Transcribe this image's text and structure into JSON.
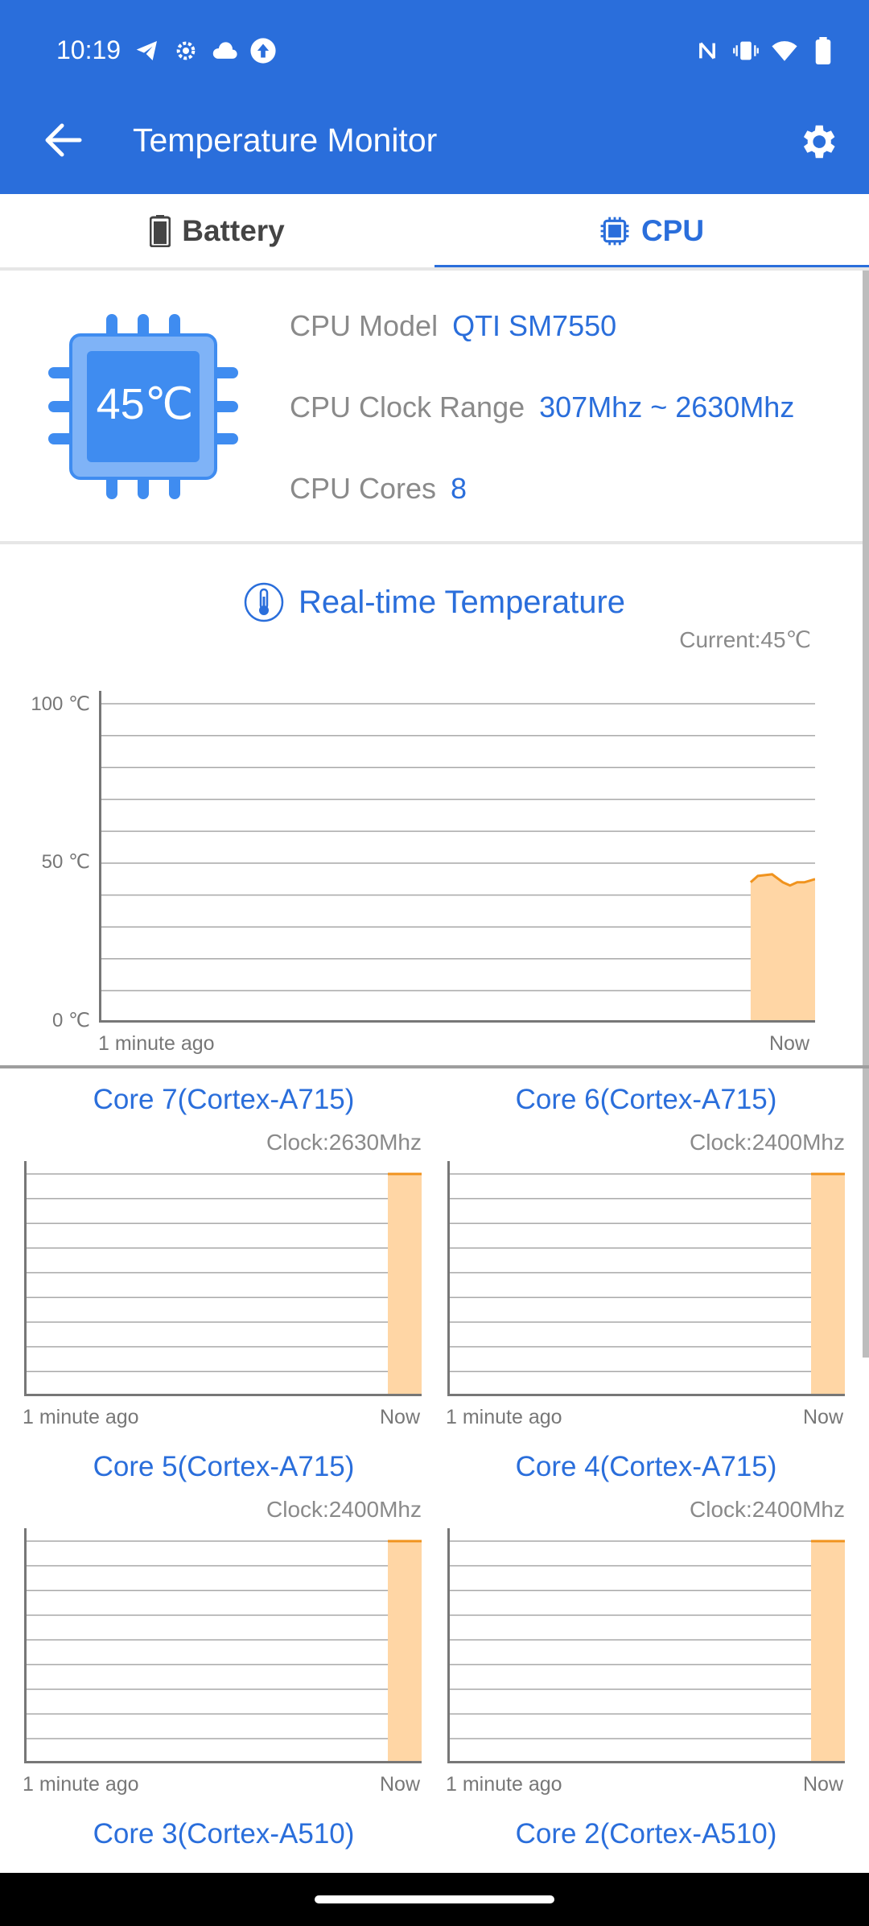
{
  "status_bar": {
    "time": "10:19",
    "left_icons": [
      "telegram-icon",
      "settings-icon",
      "cloud-icon",
      "upload-icon"
    ],
    "right_icons": [
      "nfc-icon",
      "vibrate-icon",
      "wifi-icon",
      "battery-icon"
    ]
  },
  "appbar": {
    "title": "Temperature Monitor",
    "color": "#2A6EDB"
  },
  "tabs": [
    {
      "label": "Battery",
      "icon": "battery-icon",
      "selected": false
    },
    {
      "label": "CPU",
      "icon": "chip-icon",
      "selected": true
    }
  ],
  "cpu_info": {
    "temperature": "45℃",
    "model_label": "CPU Model",
    "model_value": "QTI SM7550",
    "clock_label": "CPU Clock Range",
    "clock_value": "307Mhz ~ 2630Mhz",
    "cores_label": "CPU Cores",
    "cores_value": "8"
  },
  "realtime": {
    "title": "Real-time Temperature",
    "current": "Current:45℃"
  },
  "chart_data": [
    {
      "type": "area",
      "title": "Real-time Temperature",
      "ylim": [
        0,
        100
      ],
      "y_ticks": [
        "100 ℃",
        "50 ℃",
        "0 ℃"
      ],
      "x_labels": [
        "1 minute ago",
        "Now"
      ],
      "grid": true,
      "fill_color": "#FFD6A5",
      "line_color": "#F0931E",
      "x": [
        0.91,
        0.92,
        0.94,
        0.955,
        0.965,
        0.975,
        0.985,
        1.0
      ],
      "values": [
        44,
        46,
        46.5,
        44,
        43,
        44,
        44,
        45
      ]
    },
    {
      "type": "area",
      "title": "Core 7(Cortex-A715)",
      "clock": "Clock:2630Mhz",
      "x_labels": [
        "1 minute ago",
        "Now"
      ],
      "grid": true,
      "x": [
        0.915,
        1.0
      ],
      "values": [
        1,
        1
      ]
    },
    {
      "type": "area",
      "title": "Core 6(Cortex-A715)",
      "clock": "Clock:2400Mhz",
      "x_labels": [
        "1 minute ago",
        "Now"
      ],
      "grid": true,
      "x": [
        0.915,
        1.0
      ],
      "values": [
        1,
        1
      ]
    },
    {
      "type": "area",
      "title": "Core 5(Cortex-A715)",
      "clock": "Clock:2400Mhz",
      "x_labels": [
        "1 minute ago",
        "Now"
      ],
      "grid": true,
      "x": [
        0.915,
        1.0
      ],
      "values": [
        1,
        1
      ]
    },
    {
      "type": "area",
      "title": "Core 4(Cortex-A715)",
      "clock": "Clock:2400Mhz",
      "x_labels": [
        "1 minute ago",
        "Now"
      ],
      "grid": true,
      "x": [
        0.915,
        1.0
      ],
      "values": [
        1,
        1
      ]
    }
  ],
  "cores_partial": [
    {
      "title": "Core 3(Cortex-A510)"
    },
    {
      "title": "Core 2(Cortex-A510)"
    }
  ]
}
